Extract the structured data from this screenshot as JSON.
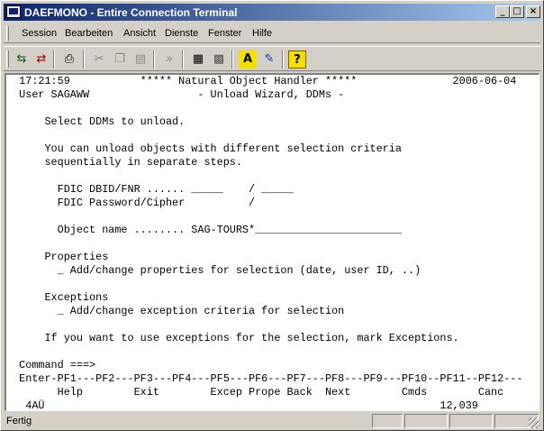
{
  "window": {
    "title": "DAEFMONO - Entire Connection Terminal",
    "minimize_glyph": "_",
    "maximize_glyph": "□",
    "close_glyph": "×"
  },
  "menu": [
    {
      "label": "Session"
    },
    {
      "label": "Bearbeiten"
    },
    {
      "label": "Ansicht"
    },
    {
      "label": "Dienste"
    },
    {
      "label": "Fenster"
    },
    {
      "label": "Hilfe"
    }
  ],
  "toolbar": [
    {
      "icon": "connect-icon",
      "glyph": "⇆"
    },
    {
      "icon": "disconnect-icon",
      "glyph": "⇄"
    },
    {
      "icon": "print-icon",
      "glyph": "⎙"
    },
    {
      "icon": "cut-icon",
      "glyph": "✂"
    },
    {
      "icon": "copy-icon",
      "glyph": "❐"
    },
    {
      "icon": "paste-icon",
      "glyph": "▤"
    },
    {
      "icon": "transfer-icon",
      "glyph": "»"
    },
    {
      "icon": "log-icon",
      "glyph": "▦"
    },
    {
      "icon": "session-icon",
      "glyph": "▩"
    },
    {
      "icon": "font-icon",
      "glyph": "A"
    },
    {
      "icon": "color-icon",
      "glyph": "✎"
    },
    {
      "icon": "help-icon",
      "glyph": "?"
    }
  ],
  "terminal": {
    "lines": [
      "  17:21:59           ***** Natural Object Handler *****               2006-06-04",
      "  User SAGAWW                 - Unload Wizard, DDMs -",
      "",
      "      Select DDMs to unload.",
      "",
      "      You can unload objects with different selection criteria",
      "      sequentially in separate steps.",
      "",
      "        FDIC DBID/FNR ...... _____    / _____",
      "        FDIC Password/Cipher          /",
      "",
      "        Object name ........ SAG-TOURS*_______________________",
      "",
      "      Properties",
      "        _ Add/change properties for selection (date, user ID, ..)",
      "",
      "      Exceptions",
      "        _ Add/change exception criteria for selection",
      "",
      "      If you want to use exceptions for the selection, mark Exceptions.",
      "",
      "  Command ===>",
      "  Enter-PF1---PF2---PF3---PF4---PF5---PF6---PF7---PF8---PF9---PF10--PF11--PF12---",
      "        Help        Exit        Excep Prope Back  Next        Cmds        Canc",
      "   4AÜ                                                              12,039"
    ]
  },
  "status": {
    "text": "Fertig"
  }
}
